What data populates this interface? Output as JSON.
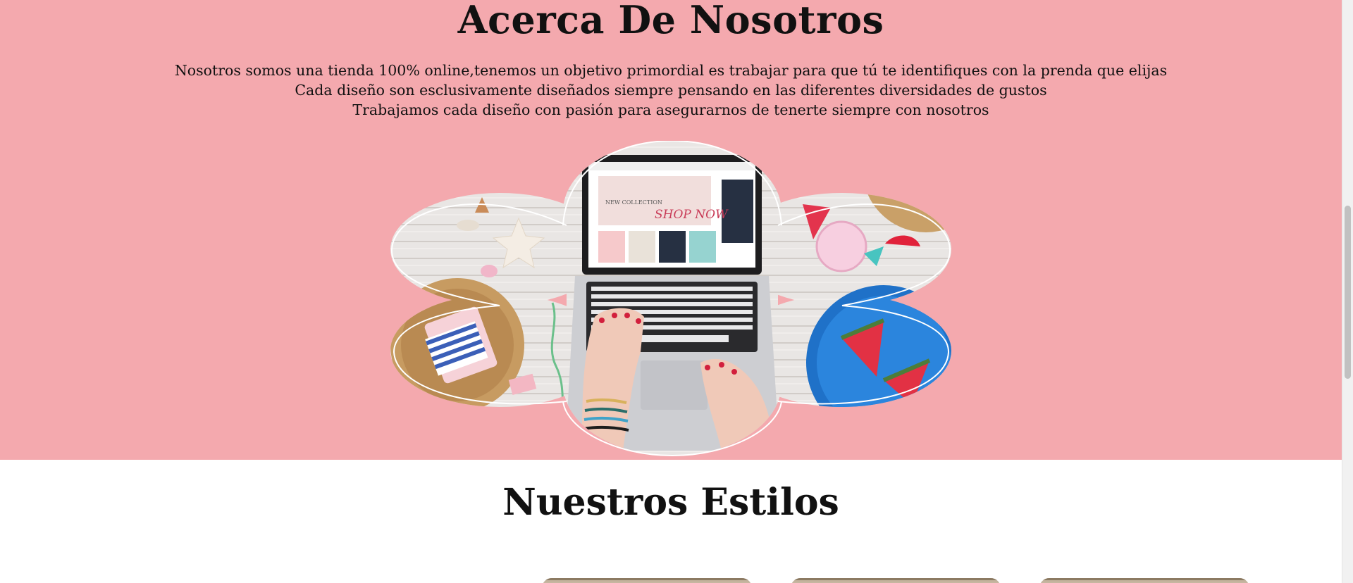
{
  "colors": {
    "about_bg": "#f4a9ae",
    "text": "#111111"
  },
  "about": {
    "title": "Acerca De Nosotros",
    "lines": [
      "Nosotros somos una tienda 100% online,tenemos un objetivo primordial es trabajar para que tú te identifiques con la prenda que elijas",
      "Cada diseño son esclusivamente diseñados siempre pensando en las diferentes diversidades de gustos",
      "Trabajamos cada diseño con pasión para asegurarnos de tenerte siempre con nosotros"
    ],
    "image": {
      "screen_text_1": "NEW COLLECTION",
      "screen_text_2": "SHOP NOW"
    }
  },
  "styles": {
    "title": "Nuestros Estilos"
  }
}
